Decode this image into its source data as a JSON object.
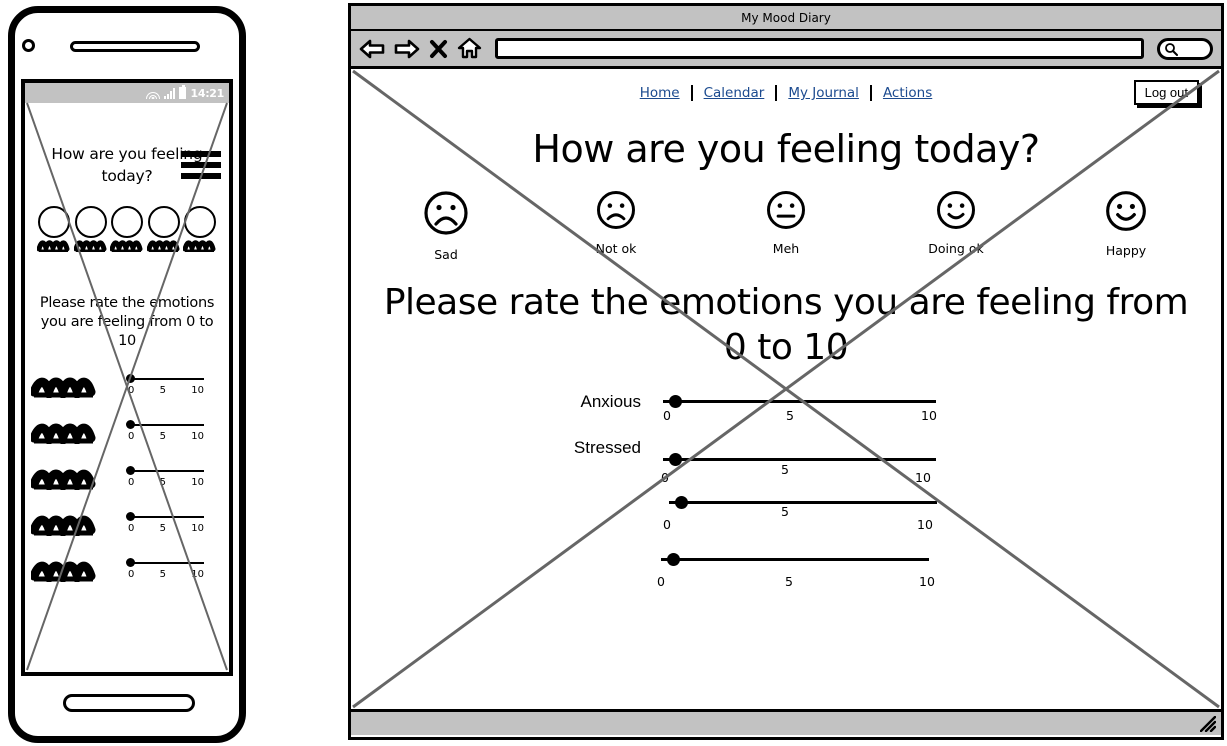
{
  "browser": {
    "window_title": "My Mood Diary",
    "toolbar": {
      "back_icon": "back-arrow-icon",
      "forward_icon": "forward-arrow-icon",
      "stop_icon": "close-x-icon",
      "home_icon": "home-icon",
      "url_value": "",
      "url_placeholder": "",
      "search_icon": "search-icon"
    }
  },
  "nav": {
    "links": [
      {
        "label": "Home"
      },
      {
        "label": "Calendar"
      },
      {
        "label": "My Journal"
      },
      {
        "label": "Actions"
      }
    ],
    "logout_label": "Log out",
    "link_color": "#1b4a8f"
  },
  "page": {
    "heading1": "How are you feeling today?",
    "heading2": "Please rate the emotions you are feeling from 0 to 10",
    "moods": [
      {
        "label": "Sad",
        "icon": "sad-face-icon"
      },
      {
        "label": "Not ok",
        "icon": "frown-face-icon"
      },
      {
        "label": "Meh",
        "icon": "neutral-face-icon"
      },
      {
        "label": "Doing ok",
        "icon": "smile-face-icon"
      },
      {
        "label": "Happy",
        "icon": "happy-face-icon"
      }
    ],
    "sliders": [
      {
        "label": "Anxious",
        "value": "0",
        "ticks": [
          "0",
          "5",
          "10"
        ],
        "min": "0",
        "max": "10"
      },
      {
        "label": "Stressed",
        "value": "0",
        "ticks": [
          "0",
          "5",
          "10"
        ],
        "min": "0",
        "max": "10"
      },
      {
        "label": "",
        "value": "0",
        "ticks": [
          "0",
          "5",
          "10"
        ],
        "min": "0",
        "max": "10"
      },
      {
        "label": "",
        "value": "0",
        "ticks": [
          "0",
          "5",
          "10"
        ],
        "min": "0",
        "max": "10"
      }
    ]
  },
  "phone": {
    "status_bar": {
      "time": "14:21",
      "wifi_icon": "wifi-icon",
      "signal_icon": "signal-bars-icon",
      "battery_icon": "battery-icon"
    },
    "menu_icon": "hamburger-menu-icon",
    "heading1": "How are you feeling today?",
    "heading2": "Please rate the emotions you are feeling from 0 to 10",
    "mood_count": 5,
    "sliders": [
      {
        "ticks": [
          "0",
          "5",
          "10"
        ]
      },
      {
        "ticks": [
          "0",
          "5",
          "10"
        ]
      },
      {
        "ticks": [
          "0",
          "5",
          "10"
        ]
      },
      {
        "ticks": [
          "0",
          "5",
          "10"
        ]
      },
      {
        "ticks": [
          "0",
          "5",
          "10"
        ]
      }
    ]
  },
  "colors": {
    "chrome_gray": "#c2c2c2",
    "cross_gray": "#666666",
    "outline_black": "#000000"
  }
}
